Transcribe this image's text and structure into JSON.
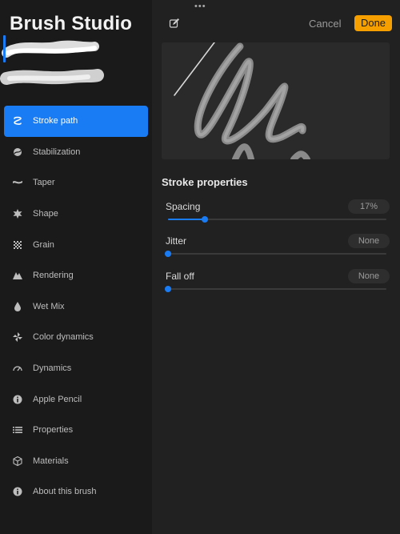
{
  "app": {
    "title": "Brush Studio"
  },
  "toolbar": {
    "more_label": "•••",
    "cancel_label": "Cancel",
    "done_label": "Done",
    "edit_icon": "edit-icon"
  },
  "sidebar": {
    "items": [
      {
        "label": "Stroke path",
        "icon": "stroke-path-icon",
        "active": true
      },
      {
        "label": "Stabilization",
        "icon": "stabilization-icon"
      },
      {
        "label": "Taper",
        "icon": "taper-icon"
      },
      {
        "label": "Shape",
        "icon": "shape-icon"
      },
      {
        "label": "Grain",
        "icon": "grain-icon"
      },
      {
        "label": "Rendering",
        "icon": "rendering-icon"
      },
      {
        "label": "Wet Mix",
        "icon": "wet-mix-icon"
      },
      {
        "label": "Color dynamics",
        "icon": "color-dynamics-icon"
      },
      {
        "label": "Dynamics",
        "icon": "dynamics-icon"
      },
      {
        "label": "Apple Pencil",
        "icon": "apple-pencil-icon"
      },
      {
        "label": "Properties",
        "icon": "properties-icon"
      },
      {
        "label": "Materials",
        "icon": "materials-icon"
      },
      {
        "label": "About this brush",
        "icon": "about-icon"
      }
    ]
  },
  "main": {
    "section_title": "Stroke properties",
    "properties": [
      {
        "label": "Spacing",
        "value": "17%",
        "fraction": 0.17
      },
      {
        "label": "Jitter",
        "value": "None",
        "fraction": 0.0
      },
      {
        "label": "Fall off",
        "value": "None",
        "fraction": 0.0
      }
    ]
  },
  "colors": {
    "accent": "#1a7cf5",
    "done": "#f5a000",
    "background": "#212121",
    "sidebar": "#1a1a1a"
  }
}
